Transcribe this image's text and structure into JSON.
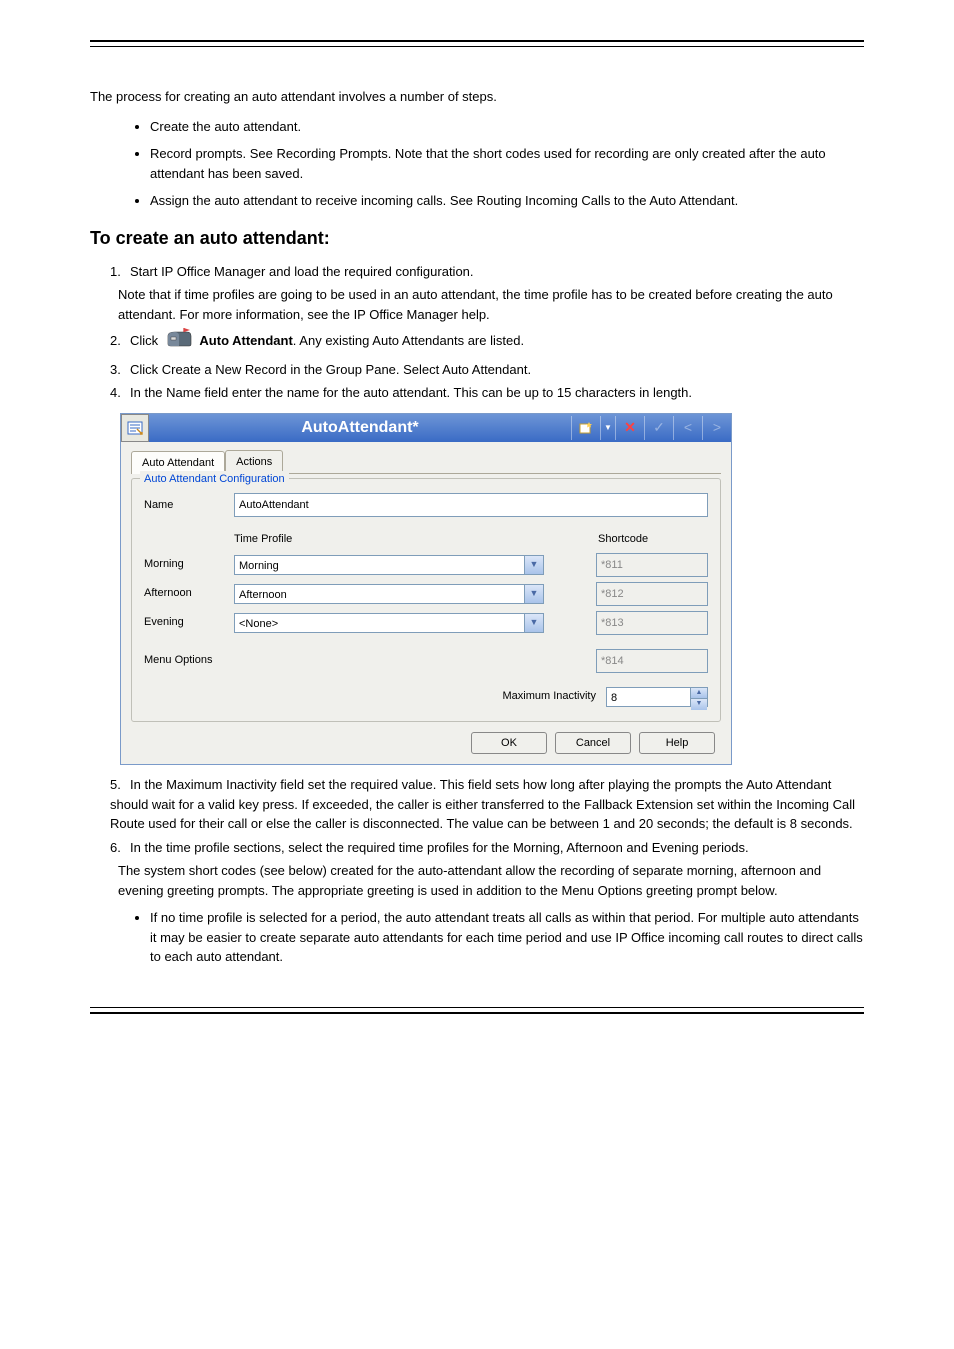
{
  "intro_p1": "The process for creating an auto attendant involves a number of steps.",
  "intro_bullets": [
    "Create the auto attendant.",
    "Record prompts. See Recording Prompts. Note that the short codes used for recording are only created after the auto attendant has been saved.",
    "Assign the auto attendant to receive incoming calls. See Routing Incoming Calls to the Auto Attendant."
  ],
  "section_heading": "To create an auto attendant:",
  "step1_prefix": "Start IP Office Manager and load the required configuration.",
  "step1_note": "Note that if time profiles are going to be used in an auto attendant, the time profile has to be created before creating the auto attendant. For more information, see the IP Office Manager help.",
  "step2_prefix": "Click ",
  "step2_mid": " Auto Attendant",
  "step2_suffix": ". Any existing Auto Attendants are listed.",
  "step3": "Click Create a New Record in the Group Pane. Select Auto Attendant.",
  "step4": "In the Name field enter the name for the auto attendant. This can be up to 15 characters in length.",
  "dialog": {
    "title": "AutoAttendant*",
    "tab_autoattendant": "Auto Attendant",
    "tab_actions": "Actions",
    "group_title": "Auto Attendant Configuration",
    "name_label": "Name",
    "name_value": "AutoAttendant",
    "timeprofile_header": "Time Profile",
    "shortcode_header": "Shortcode",
    "rows": {
      "morning": {
        "label": "Morning",
        "profile": "Morning",
        "shortcode": "*811"
      },
      "afternoon": {
        "label": "Afternoon",
        "profile": "Afternoon",
        "shortcode": "*812"
      },
      "evening": {
        "label": "Evening",
        "profile": "<None>",
        "shortcode": "*813"
      }
    },
    "menu_options_label": "Menu Options",
    "menu_options_shortcode": "*814",
    "max_inactivity_label": "Maximum Inactivity",
    "max_inactivity_value": "8",
    "buttons": {
      "ok": "OK",
      "cancel": "Cancel",
      "help": "Help"
    }
  },
  "step5": "In the Maximum Inactivity field set the required value. This field sets how long after playing the prompts the Auto Attendant should wait for a valid key press. If exceeded, the caller is either transferred to the Fallback Extension set within the Incoming Call Route used for their call or else the caller is disconnected. The value can be between 1 and 20 seconds; the default is 8 seconds.",
  "step6": "In the time profile sections, select the required time profiles for the Morning, Afternoon and Evening periods.",
  "step6_sub": "The system short codes (see below) created for the auto-attendant allow the recording of separate morning, afternoon and evening greeting prompts. The appropriate greeting is used in addition to the Menu Options greeting prompt below.",
  "step6_bullet": "If no time profile is selected for a period, the auto attendant treats all calls as within that period. For multiple auto attendants it may be easier to create separate auto attendants for each time period and use IP Office incoming call routes to direct calls to each auto attendant."
}
